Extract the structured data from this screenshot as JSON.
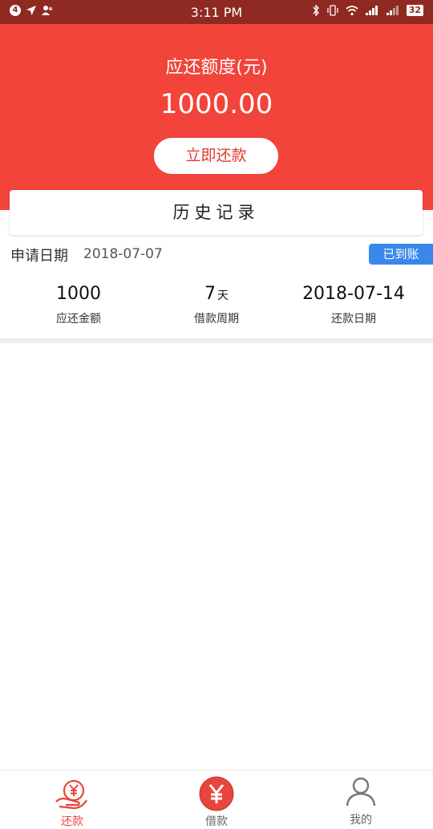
{
  "status_bar": {
    "notif_count": "4",
    "time": "3:11 PM",
    "battery": "32"
  },
  "hero": {
    "title": "应还额度(元)",
    "amount": "1000.00",
    "repay_button": "立即还款"
  },
  "history": {
    "title": "历史记录"
  },
  "record": {
    "apply_label": "申请日期",
    "apply_date": "2018-07-07",
    "status": "已到账",
    "amount_value": "1000",
    "amount_label": "应还金额",
    "period_value": "7",
    "period_unit": "天",
    "period_label": "借款周期",
    "due_value": "2018-07-14",
    "due_label": "还款日期"
  },
  "tabbar": {
    "items": [
      {
        "label": "还款",
        "icon": "repay-hand-yen-icon",
        "active": true
      },
      {
        "label": "借款",
        "icon": "yen-coin-icon",
        "active": false
      },
      {
        "label": "我的",
        "icon": "user-icon",
        "active": false
      }
    ]
  },
  "colors": {
    "brand_red": "#f2443a",
    "status_bar": "#8f2a22",
    "badge_blue": "#3a87ea",
    "tab_inactive": "#666666"
  }
}
